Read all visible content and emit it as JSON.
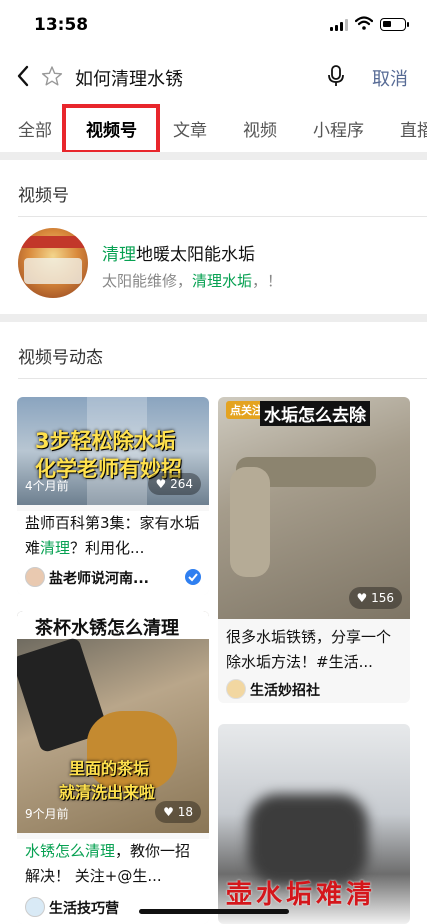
{
  "status": {
    "time": "13:58",
    "battery_level": 0.4
  },
  "search": {
    "query": "如何清理水锈",
    "cancel_label": "取消"
  },
  "tabs": [
    {
      "label": "全部",
      "active": false
    },
    {
      "label": "视频号",
      "active": true
    },
    {
      "label": "文章",
      "active": false
    },
    {
      "label": "视频",
      "active": false
    },
    {
      "label": "小程序",
      "active": false
    },
    {
      "label": "直播",
      "active": false
    }
  ],
  "account_section": {
    "title": "视频号",
    "account": {
      "name_highlight": "清理",
      "name_rest": "地暖太阳能水垢",
      "desc_prefix": "太阳能维修，",
      "desc_highlight": "清理水垢",
      "desc_suffix": "，！"
    }
  },
  "feed_section": {
    "title": "视频号动态",
    "cards": [
      {
        "overlay_line1": "3步轻松除水垢",
        "overlay_line2": "化学老师有妙招",
        "time": "4个月前",
        "likes": "264",
        "title_a": "盐师百科第3集：家有水垢难",
        "title_hl": "清理",
        "title_b": "？利用化...",
        "author": "盐老师说河南...",
        "verified": true
      },
      {
        "badge": "点关注",
        "overlay_title": "水垢怎么去除",
        "likes": "156",
        "title": "很多水垢铁锈，分享一个除水垢方法！#生活...",
        "author": "生活妙招社"
      },
      {
        "overlay_title": "茶杯水锈怎么清理",
        "overlay_line1": "里面的茶垢",
        "overlay_line2": "就清洗出来啦",
        "time": "9个月前",
        "likes": "18",
        "title_hl": "水锈怎么清理",
        "title_b": "，教你一招解决！ 关注+@生...",
        "author": "生活技巧营"
      },
      {
        "overlay_text": "壶水垢难清"
      }
    ]
  },
  "colors": {
    "accent_green": "#07c160",
    "highlight_green": "#07a152",
    "link_blue": "#576b95",
    "annotation_red": "#e8262c"
  }
}
